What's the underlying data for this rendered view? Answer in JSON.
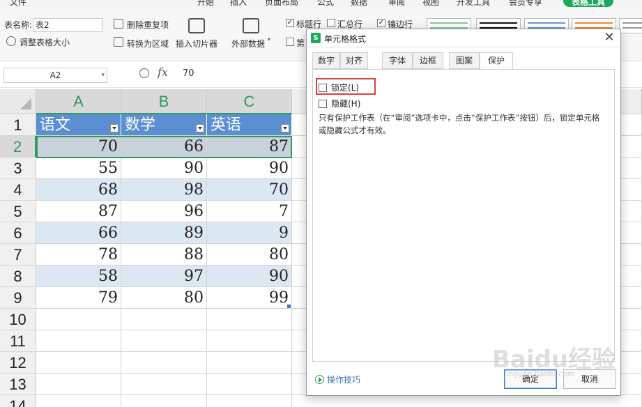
{
  "menu": {
    "items": [
      "文件",
      "开始",
      "插入",
      "页面布局",
      "公式",
      "数据",
      "审阅",
      "视图",
      "开发工具",
      "会员专享"
    ],
    "table_tools": "表格工具"
  },
  "ribbon": {
    "table_name_label": "表名称:",
    "table_name_value": "表2",
    "resize_table": "调整表格大小",
    "remove_duplicates": "删除重复项",
    "convert_to_range": "转换为区域",
    "insert_slicer": "插入切片器",
    "external_data": "外部数据",
    "header_row": "标题行",
    "total_row": "汇总行",
    "banded_rows": "镶边行",
    "first_col": "第",
    "colors": {
      "accent": "#2e9b5c",
      "header_blue": "#5b8fd1",
      "band": "#dce7f4"
    }
  },
  "formula_bar": {
    "cell_ref": "A2",
    "fx": "fx",
    "value": "70"
  },
  "sheet": {
    "columns": [
      "A",
      "B",
      "C"
    ],
    "rows": [
      "1",
      "2",
      "3",
      "4",
      "5",
      "6",
      "7",
      "8",
      "9",
      "10",
      "11",
      "12",
      "13",
      "14"
    ],
    "headers": [
      "语文",
      "数学",
      "英语"
    ],
    "data": [
      [
        "70",
        "66",
        "87"
      ],
      [
        "55",
        "90",
        "90"
      ],
      [
        "68",
        "98",
        "70"
      ],
      [
        "87",
        "96",
        "7"
      ],
      [
        "66",
        "89",
        "9"
      ],
      [
        "78",
        "88",
        "80"
      ],
      [
        "58",
        "97",
        "90"
      ],
      [
        "79",
        "80",
        "99"
      ]
    ]
  },
  "dialog": {
    "title": "单元格格式",
    "tabs": [
      "数字",
      "对齐",
      "字体",
      "边框",
      "图案",
      "保护"
    ],
    "active_tab": "保护",
    "lock_label": "锁定(L)",
    "hidden_label": "隐藏(H)",
    "note": "只有保护工作表（在“审阅”选项卡中，点击“保护工作表”按钮）后，锁定单元格或隐藏公式才有效。",
    "tips": "操作技巧",
    "ok": "确定",
    "cancel": "取消"
  },
  "watermark": {
    "text": "Baidu经验",
    "sub": "jingyan.baidu.com"
  }
}
